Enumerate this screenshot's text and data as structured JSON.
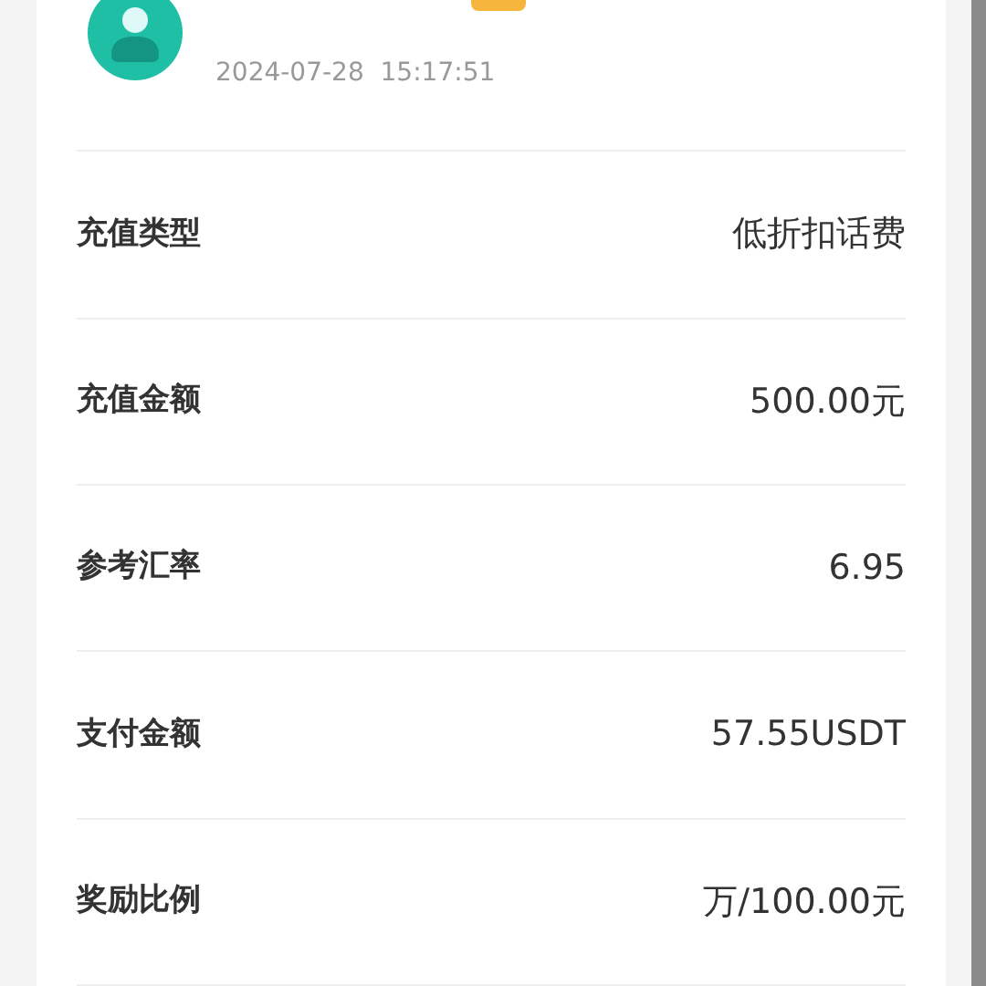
{
  "header": {
    "time": "2024-07-28  15:17:51"
  },
  "rows": [
    {
      "label": "充值类型",
      "value": "低折扣话费"
    },
    {
      "label": "充值金额",
      "value": "500.00元"
    },
    {
      "label": "参考汇率",
      "value": "6.95"
    },
    {
      "label": "支付金额",
      "value": "57.55USDT"
    },
    {
      "label": "奖励比例",
      "value": "万/100.00元"
    }
  ]
}
